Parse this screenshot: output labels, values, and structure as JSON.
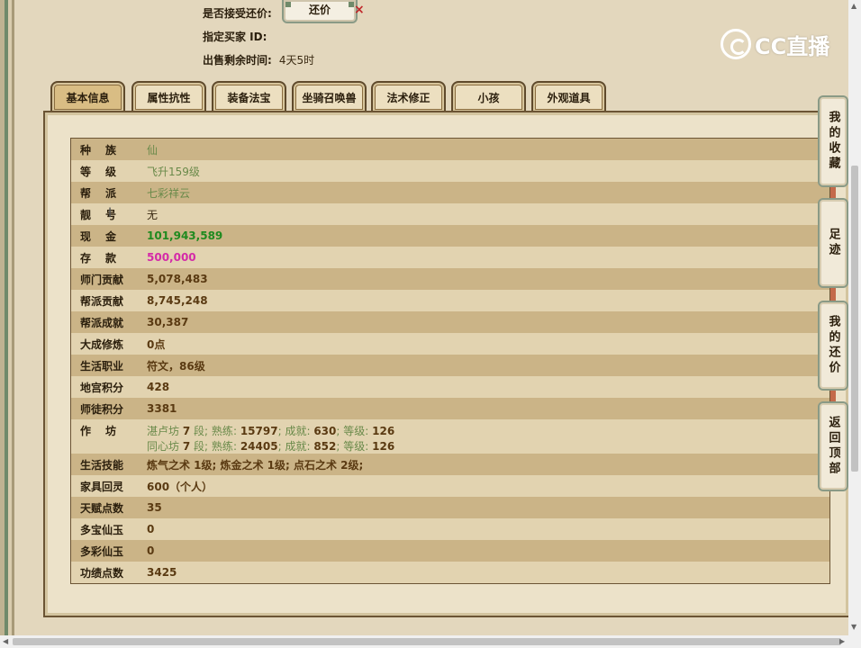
{
  "top_info": {
    "accept_bargain_label": "是否接受还价:",
    "bargain_button_label": "还价",
    "close_symbol": "×",
    "buyer_id_label": "指定买家 ID:",
    "time_left_label": "出售剩余时间:",
    "time_left_value": "4天5时"
  },
  "logo": {
    "text": "CC直播"
  },
  "tabs": [
    {
      "label": "基本信息",
      "active": true
    },
    {
      "label": "属性抗性"
    },
    {
      "label": "装备法宝"
    },
    {
      "label": "坐骑召唤兽"
    },
    {
      "label": "法术修正"
    },
    {
      "label": "小孩"
    },
    {
      "label": "外观道具"
    }
  ],
  "info": {
    "race_label": "种族",
    "race_value": "仙",
    "level_label": "等级",
    "level_value": "飞升159级",
    "faction_label": "帮派",
    "faction_value": "七彩祥云",
    "title_label": "靓号",
    "title_value": "无",
    "cash_label": "现金",
    "cash_value": "101,943,589",
    "deposit_label": "存款",
    "deposit_value": "500,000",
    "master_contrib_label": "师门贡献",
    "master_contrib_value": "5,078,483",
    "faction_contrib_label": "帮派贡献",
    "faction_contrib_value": "8,745,248",
    "faction_achieve_label": "帮派成就",
    "faction_achieve_value": "30,387",
    "cultivation_label": "大成修炼",
    "cultivation_value": "0点",
    "profession_label": "生活职业",
    "profession_value": "符文，86级",
    "palace_label": "地宫积分",
    "palace_value": "428",
    "disciple_label": "师徒积分",
    "disciple_value": "3381",
    "workshop_label": "作坊",
    "workshops": [
      {
        "name": "湛卢坊",
        "rank": "7",
        "rank_unit": "段",
        "skill_label": "熟练",
        "skill": "15797",
        "achieve_label": "成就",
        "achieve": "630",
        "level_label": "等级",
        "level": "126"
      },
      {
        "name": "同心坊",
        "rank": "7",
        "rank_unit": "段",
        "skill_label": "熟练",
        "skill": "24405",
        "achieve_label": "成就",
        "achieve": "852",
        "level_label": "等级",
        "level": "126"
      }
    ],
    "life_skill_label": "生活技能",
    "life_skill_value": "炼气之术 1级; 炼金之术 1级; 点石之术 2级;",
    "home_label": "家具回灵",
    "home_value": "600（个人）",
    "talent_label": "天赋点数",
    "talent_value": "35",
    "treasure_jade_label": "多宝仙玉",
    "treasure_jade_value": "0",
    "color_jade_label": "多彩仙玉",
    "color_jade_value": "0",
    "merit_label": "功绩点数",
    "merit_value": "3425"
  },
  "side_nav": [
    {
      "label": "我的收藏"
    },
    {
      "label": "足迹"
    },
    {
      "label": "我的还价"
    },
    {
      "label": "返回顶部"
    }
  ],
  "colors": {
    "page_bg": "#e3d7bd",
    "money_green": "#1f8a1f",
    "deposit_pink": "#d42aa8",
    "value_green": "#6a8a4a"
  }
}
